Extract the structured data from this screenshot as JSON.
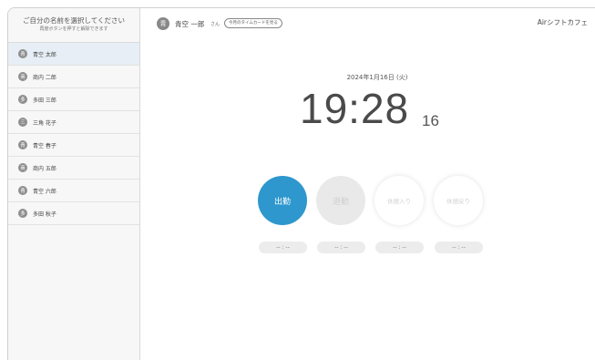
{
  "sidebar": {
    "title": "ご自分の名前を選択してください",
    "subtitle": "再度ボタンを押すと解除できます",
    "employees": [
      {
        "initial": "青",
        "name": "青空 太郎",
        "selected": true
      },
      {
        "initial": "商",
        "name": "商内 二郎",
        "selected": false
      },
      {
        "initial": "多",
        "name": "多田 三郎",
        "selected": false
      },
      {
        "initial": "三",
        "name": "三角 花子",
        "selected": false
      },
      {
        "initial": "青",
        "name": "青空 春子",
        "selected": false
      },
      {
        "initial": "商",
        "name": "商内 五郎",
        "selected": false
      },
      {
        "initial": "青",
        "name": "青空 六郎",
        "selected": false
      },
      {
        "initial": "多",
        "name": "多田 秋子",
        "selected": false
      }
    ]
  },
  "header": {
    "user_initial": "青",
    "user_name": "青空 一郎",
    "user_suffix": "さん",
    "timecard_link": "今月のタイムカードを見る",
    "brand": "Airシフトカフェ"
  },
  "clock": {
    "date": "2024年1月16日 (火)",
    "time": "19:28",
    "seconds": "16"
  },
  "actions": {
    "clock_in": "出勤",
    "clock_out": "退勤",
    "break_start": "休憩入り",
    "break_end": "休憩戻り"
  },
  "times": {
    "clock_in": "-- : --",
    "clock_out": "-- : --",
    "break_start": "-- : --",
    "break_end": "-- : --"
  },
  "colors": {
    "accent": "#2e97cd",
    "selected_row": "#e7eef5",
    "sidebar_bg": "#f7f7f7"
  }
}
